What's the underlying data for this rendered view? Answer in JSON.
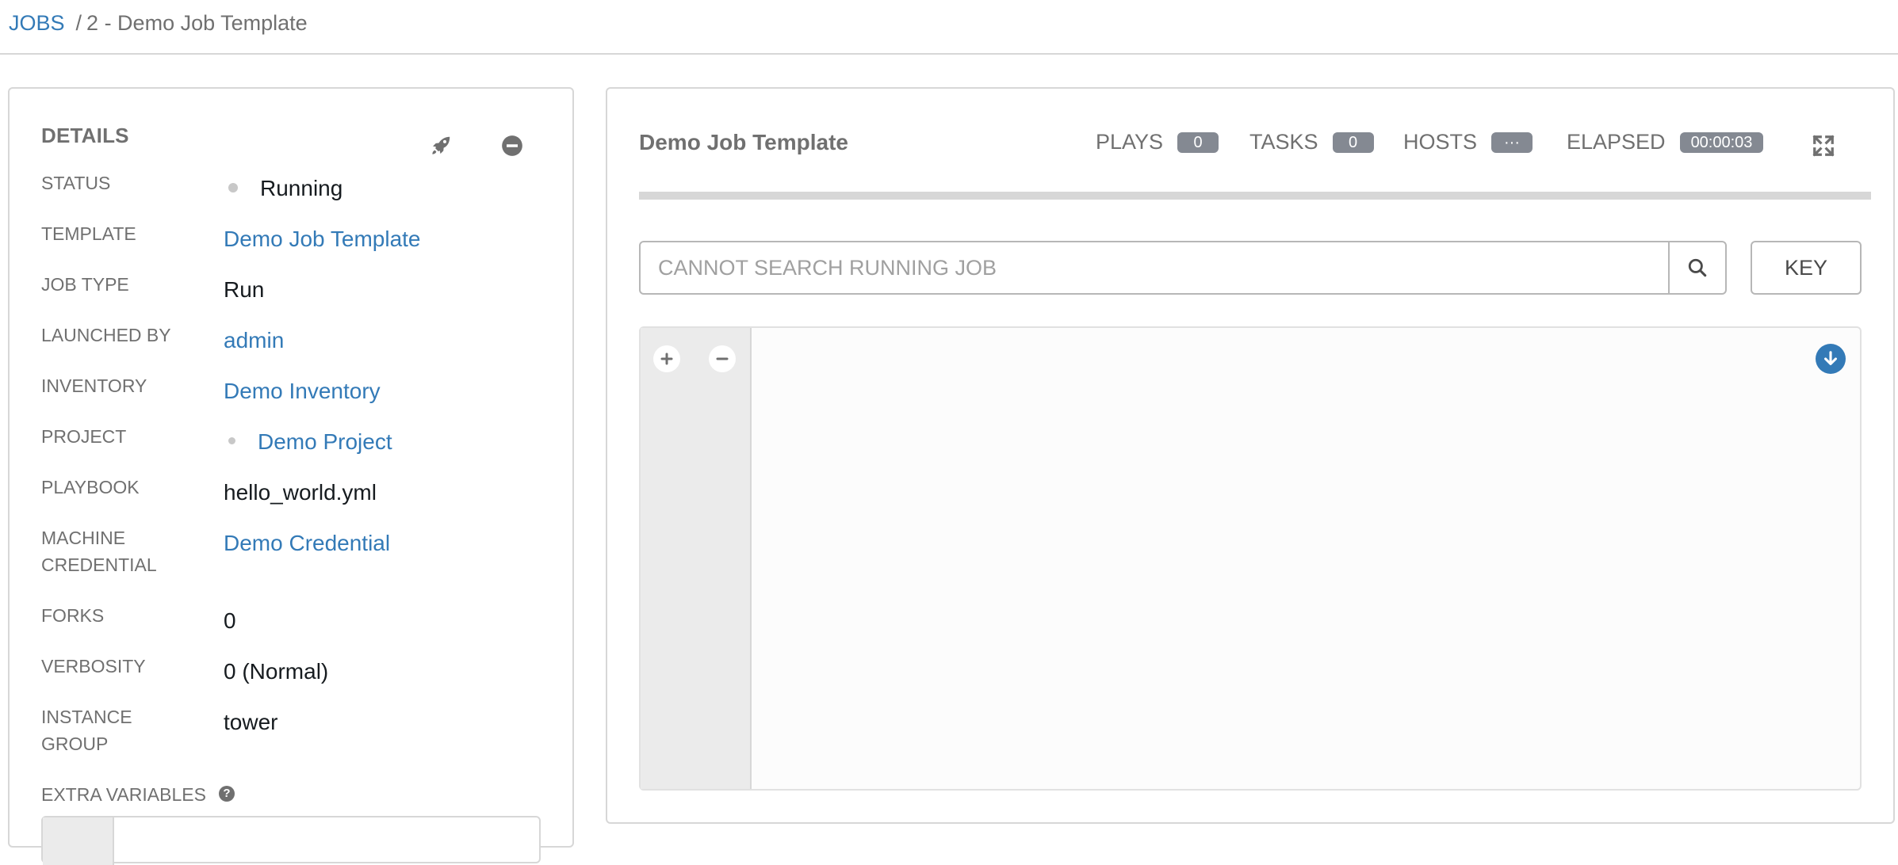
{
  "breadcrumb": {
    "root": "JOBS",
    "current": "2 - Demo Job Template"
  },
  "details": {
    "title": "DETAILS",
    "launch_icon": "rocket-icon",
    "cancel_icon": "minus-circle-icon",
    "status": {
      "label": "STATUS",
      "value": "Running"
    },
    "template": {
      "label": "TEMPLATE",
      "value": "Demo Job Template"
    },
    "job_type": {
      "label": "JOB TYPE",
      "value": "Run"
    },
    "launched_by": {
      "label": "LAUNCHED BY",
      "value": "admin"
    },
    "inventory": {
      "label": "INVENTORY",
      "value": "Demo Inventory"
    },
    "project": {
      "label": "PROJECT",
      "value": "Demo Project"
    },
    "playbook": {
      "label": "PLAYBOOK",
      "value": "hello_world.yml"
    },
    "machine_credential": {
      "label_line1": "MACHINE",
      "label_line2": "CREDENTIAL",
      "value": "Demo Credential"
    },
    "forks": {
      "label": "FORKS",
      "value": "0"
    },
    "verbosity": {
      "label": "VERBOSITY",
      "value": "0 (Normal)"
    },
    "instance_group": {
      "label_line1": "INSTANCE",
      "label_line2": "GROUP",
      "value": "tower"
    },
    "extra_variables": {
      "label": "EXTRA VARIABLES",
      "help": "?"
    }
  },
  "output": {
    "title": "Demo Job Template",
    "plays": {
      "label": "PLAYS",
      "count": "0"
    },
    "tasks": {
      "label": "TASKS",
      "count": "0"
    },
    "hosts": {
      "label": "HOSTS",
      "count": "···"
    },
    "elapsed": {
      "label": "ELAPSED",
      "value": "00:00:03"
    },
    "fullscreen_icon": "expand-icon",
    "progress": 0,
    "search": {
      "placeholder": "CANNOT SEARCH RUNNING JOB",
      "value": ""
    },
    "key_button": "KEY"
  },
  "colors": {
    "link": "#337ab7",
    "label": "#707070",
    "badge": "#848992",
    "border": "#d7d7d7"
  }
}
